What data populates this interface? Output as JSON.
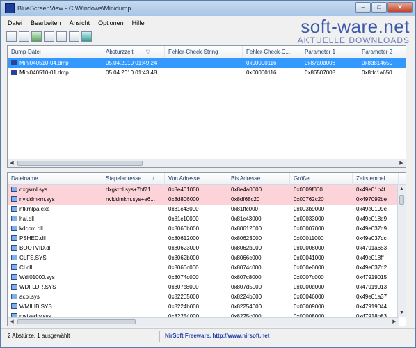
{
  "window": {
    "title": "BlueScreenView  -  C:\\Windows\\Minidump",
    "minimize": "–",
    "maximize": "□",
    "close": "✕"
  },
  "watermark": {
    "brand": "soft-ware.net",
    "sub": "AKTUELLE DOWNLOADS"
  },
  "menu": [
    "Datei",
    "Bearbeiten",
    "Ansicht",
    "Optionen",
    "Hilfe"
  ],
  "toolbar": [
    "save-report-icon",
    "save-icon",
    "refresh-icon",
    "copy-icon",
    "properties-icon",
    "find-icon",
    "exit-icon"
  ],
  "dumps": {
    "columns": [
      "Dump-Datei",
      "Absturzzeit",
      "Fehler-Check-String",
      "Fehler-Check-C...",
      "Parameter 1",
      "Parameter 2"
    ],
    "sort_indicator": "▽",
    "rows": [
      [
        "Mini040510-04.dmp",
        "05.04.2010 01:49:24",
        "",
        "0x00000116",
        "0x87a0d008",
        "0x8d814650"
      ],
      [
        "Mini040510-01.dmp",
        "05.04.2010 01:43:48",
        "",
        "0x00000116",
        "0x86507008",
        "0x8dc1a650"
      ]
    ]
  },
  "drivers": {
    "columns": [
      "Dateiname",
      "Stapeladresse",
      "Von Adresse",
      "Bis Adresse",
      "Größe",
      "Zeitstempel"
    ],
    "sort_indicator": "/",
    "rows": [
      [
        "dxgkrnl.sys",
        "dxgkrnl.sys+7bf71",
        "0x8e401000",
        "0x8e4a0000",
        "0x0009f000",
        "0x49e01b4f"
      ],
      [
        "nvlddmkm.sys",
        "nvlddmkm.sys+e6...",
        "0x8d806000",
        "0x8df68c20",
        "0x00762c20",
        "0x497092be"
      ],
      [
        "ntkrnlpa.exe",
        "",
        "0x81c43000",
        "0x81ffc000",
        "0x003b9000",
        "0x49e0199e"
      ],
      [
        "hal.dll",
        "",
        "0x81c10000",
        "0x81c43000",
        "0x00033000",
        "0x49e018d9"
      ],
      [
        "kdcom.dll",
        "",
        "0x8060b000",
        "0x80612000",
        "0x00007000",
        "0x49e037d9"
      ],
      [
        "PSHED.dll",
        "",
        "0x80612000",
        "0x80623000",
        "0x00011000",
        "0x49e037dc"
      ],
      [
        "BOOTVID.dll",
        "",
        "0x80623000",
        "0x8062b000",
        "0x00008000",
        "0x4791a653"
      ],
      [
        "CLFS.SYS",
        "",
        "0x8062b000",
        "0x8066c000",
        "0x00041000",
        "0x49e018ff"
      ],
      [
        "CI.dll",
        "",
        "0x8066c000",
        "0x8074c000",
        "0x000e0000",
        "0x49e037d2"
      ],
      [
        "Wdf01000.sys",
        "",
        "0x8074c000",
        "0x807c8000",
        "0x0007c000",
        "0x47919015"
      ],
      [
        "WDFLDR.SYS",
        "",
        "0x807c8000",
        "0x807d5000",
        "0x0000d000",
        "0x47919013"
      ],
      [
        "acpi.sys",
        "",
        "0x82205000",
        "0x8224b000",
        "0x00046000",
        "0x49e01a37"
      ],
      [
        "WMILIB.SYS",
        "",
        "0x8224b000",
        "0x82254000",
        "0x00009000",
        "0x47919044"
      ],
      [
        "msisadrv.sys",
        "",
        "0x82254000",
        "0x8225c000",
        "0x00008000",
        "0x47918b83"
      ]
    ]
  },
  "status": {
    "left": "2 Abstürze, 1 ausgewählt",
    "link": "NirSoft Freeware.  http://www.nirsoft.net"
  }
}
